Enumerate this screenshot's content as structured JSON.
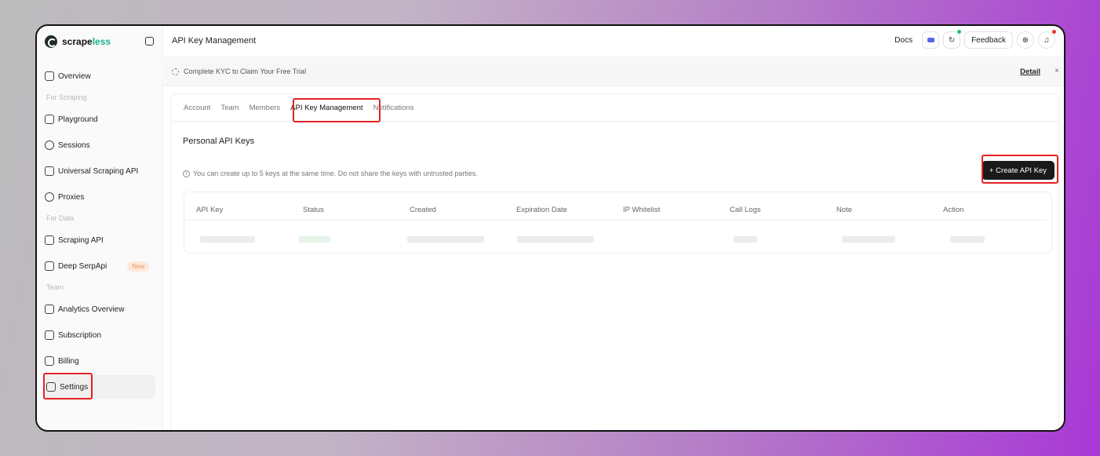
{
  "brand": {
    "name_part1": "scrape",
    "name_part2": "less",
    "accent_color": "#18b38a"
  },
  "sidebar": {
    "items": [
      {
        "label": "Overview",
        "icon": "monitor-icon"
      },
      {
        "section": "For Scraping"
      },
      {
        "label": "Playground",
        "icon": "playground-icon"
      },
      {
        "label": "Sessions",
        "icon": "sessions-icon"
      },
      {
        "label": "Universal Scraping API",
        "icon": "lock-icon"
      },
      {
        "label": "Proxies",
        "icon": "globe-icon"
      },
      {
        "section": "For Data"
      },
      {
        "label": "Scraping API",
        "icon": "scraping-api-icon"
      },
      {
        "label": "Deep SerpApi",
        "icon": "terminal-icon",
        "badge": "New"
      },
      {
        "section": "Team"
      },
      {
        "label": "Analytics Overview",
        "icon": "chart-icon"
      },
      {
        "label": "Subscription",
        "icon": "subscription-icon"
      },
      {
        "label": "Billing",
        "icon": "billing-icon"
      },
      {
        "label": "Settings",
        "icon": "settings-icon",
        "active": true
      }
    ]
  },
  "header": {
    "title": "API Key Management",
    "docs": "Docs",
    "feedback": "Feedback"
  },
  "banner": {
    "text": "Complete KYC to Claim Your Free Trial",
    "detail": "Detail",
    "close": "×"
  },
  "tabs": [
    "Account",
    "Team",
    "Members",
    "API Key Management",
    "Notifications"
  ],
  "active_tab": "API Key Management",
  "content": {
    "section_title": "Personal API Keys",
    "info": "You can create up to 5 keys at the same time. Do not share the keys with untrusted parties.",
    "create_button": "+ Create API Key"
  },
  "table": {
    "columns": [
      "API Key",
      "Status",
      "Created",
      "Expiration Date",
      "IP Whitelist",
      "Call Logs",
      "Note",
      "Action"
    ]
  },
  "colors": {
    "highlight": "#e32222",
    "button_dark": "#1a1a1a"
  }
}
